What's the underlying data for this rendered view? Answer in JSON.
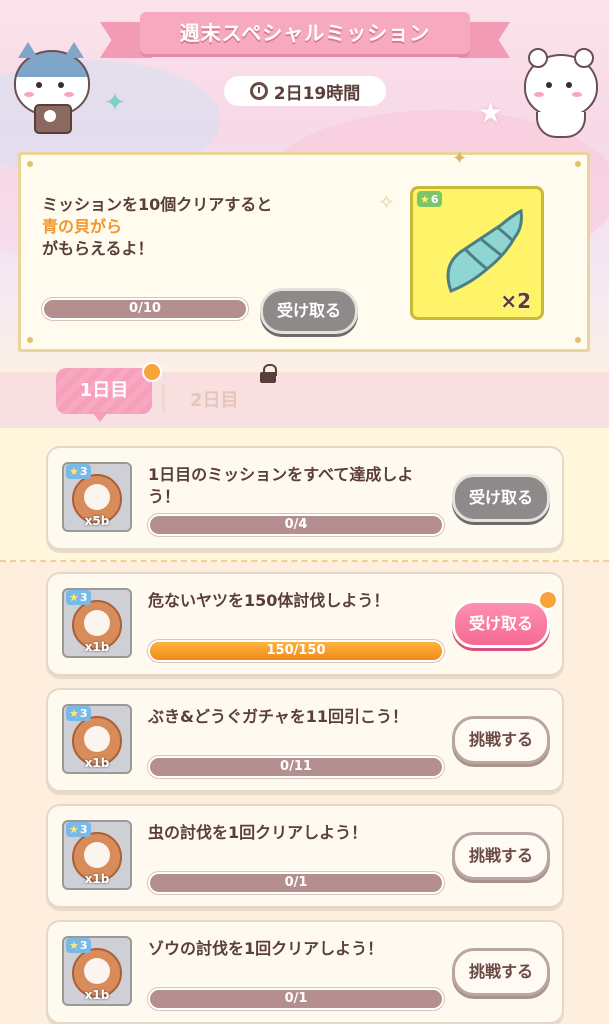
{
  "header": {
    "title": "週末スペシャルミッション",
    "timer": "2日19時間"
  },
  "panel": {
    "line1": "ミッションを10個クリアすると",
    "line2": "青の貝がら",
    "line3": "がもらえるよ！",
    "progress_text": "0/10",
    "progress": 0,
    "button": "受け取る",
    "reward_stars": "6",
    "reward_qty": "×2",
    "reward_icon": "shell-icon"
  },
  "tabs": [
    {
      "label": "1日目",
      "active": true
    },
    {
      "label": "2日目",
      "locked": true
    }
  ],
  "missions": [
    {
      "title": "1日目のミッションをすべて達成しよう！",
      "stars": "3",
      "qty": "x5b",
      "progress_text": "0/4",
      "progress": 0,
      "button": "受け取る",
      "button_style": "gray"
    },
    {
      "title": "危ないヤツを150体討伐しよう！",
      "stars": "3",
      "qty": "x1b",
      "progress_text": "150/150",
      "progress": 1,
      "button": "受け取る",
      "button_style": "pink"
    },
    {
      "title": "ぶき&どうぐガチャを11回引こう！",
      "stars": "3",
      "qty": "x1b",
      "progress_text": "0/11",
      "progress": 0,
      "button": "挑戦する",
      "button_style": "white"
    },
    {
      "title": "虫の討伐を1回クリアしよう！",
      "stars": "3",
      "qty": "x1b",
      "progress_text": "0/1",
      "progress": 0,
      "button": "挑戦する",
      "button_style": "white"
    },
    {
      "title": "ゾウの討伐を1回クリアしよう！",
      "stars": "3",
      "qty": "x1b",
      "progress_text": "0/1",
      "progress": 0,
      "button": "挑戦する",
      "button_style": "white"
    }
  ],
  "colors": {
    "accent": "#f2952c",
    "pink": "#f56a92",
    "bar": "#b58f8f"
  }
}
